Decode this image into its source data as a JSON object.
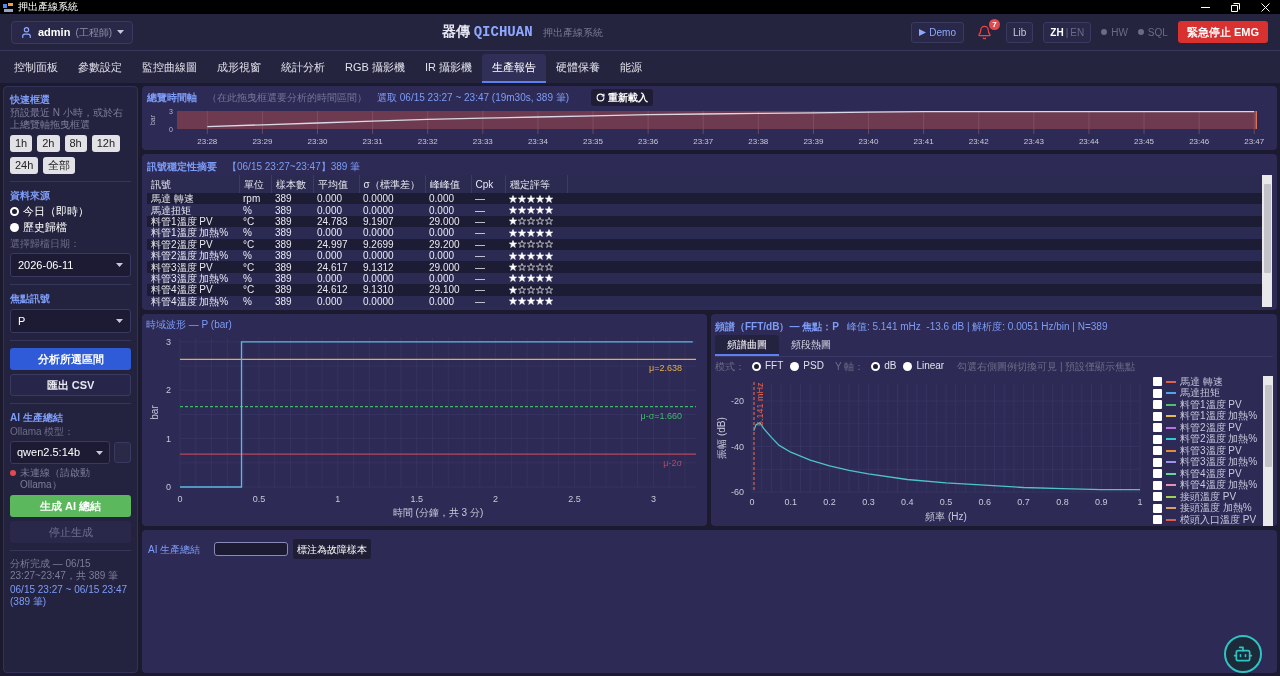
{
  "window": {
    "title": "押出產線系統"
  },
  "header": {
    "user": {
      "name": "admin",
      "role": "(工程師)"
    },
    "brand": {
      "name": "器傳",
      "name_latin": "QICHUAN",
      "subtitle": "押出產線系統"
    },
    "demo_button": "Demo",
    "notifications": {
      "count": "7"
    },
    "lib_button": "Lib",
    "language": {
      "options": [
        {
          "label": "ZH",
          "selected": true
        },
        {
          "label": "EN",
          "selected": false
        }
      ],
      "separator": "|"
    },
    "status": [
      {
        "label": "HW",
        "on": false
      },
      {
        "label": "SQL",
        "on": false
      }
    ],
    "emergency_button": "緊急停止 EMG"
  },
  "tabs": [
    {
      "label": "控制面板",
      "selected": false
    },
    {
      "label": "參數設定",
      "selected": false
    },
    {
      "label": "監控曲線圖",
      "selected": false
    },
    {
      "label": "成形視窗",
      "selected": false
    },
    {
      "label": "統計分析",
      "selected": false
    },
    {
      "label": "RGB 攝影機",
      "selected": false
    },
    {
      "label": "IR 攝影機",
      "selected": false
    },
    {
      "label": "生產報告",
      "selected": true
    },
    {
      "label": "硬體保養",
      "selected": false
    },
    {
      "label": "能源",
      "selected": false
    }
  ],
  "sidebar": {
    "quick_range": {
      "title": "快速框選",
      "hint": "預設最近 N 小時，或於右上總覽軸拖曳框選",
      "buttons": [
        "1h",
        "2h",
        "8h",
        "12h",
        "24h",
        "全部"
      ]
    },
    "source": {
      "title": "資料來源",
      "options": [
        {
          "label": "今日（即時）",
          "selected": true
        },
        {
          "label": "歷史歸檔",
          "selected": false
        }
      ],
      "date_label": "選擇歸檔日期：",
      "date_value": "2026-06-11"
    },
    "focus": {
      "title": "焦點訊號",
      "value": "P"
    },
    "analyze_button": "分析所選區間",
    "export_button": "匯出 CSV",
    "ai": {
      "title": "AI 生產總結",
      "model_label": "Ollama 模型：",
      "model": "qwen2.5:14b",
      "status": {
        "text": "未連線（請啟動 Ollama）",
        "connected": false
      },
      "generate_button": "生成 AI 總結",
      "stop_button": {
        "label": "停止生成",
        "disabled": true
      }
    },
    "result": {
      "message": "分析完成 — 06/15 23:27~23:47，共 389 筆",
      "range": "06/15 23:27 ~ 06/15 23:47 (389 筆)"
    }
  },
  "overview": {
    "title": "總覽時間軸",
    "hint": "（在此拖曳框選要分析的時間區間）",
    "selection": "選取 06/15 23:27 ~ 23:47 (19m30s, 389 筆)",
    "reload_button": "重新載入",
    "chart_data": {
      "type": "line",
      "ylabel": "bar",
      "categories": [
        "23:28",
        "23:29",
        "23:30",
        "23:31",
        "23:32",
        "23:33",
        "23:34",
        "23:35",
        "23:36",
        "23:37",
        "23:38",
        "23:39",
        "23:40",
        "23:41",
        "23:42",
        "23:43",
        "23:44",
        "23:45",
        "23:46",
        "23:47"
      ],
      "series": [
        {
          "color": "#d8d8e8",
          "values": [
            0.4,
            0.7,
            1.0,
            1.3,
            1.6,
            1.8,
            2.0,
            2.2,
            2.4,
            2.5,
            2.6,
            2.7,
            2.8,
            2.9,
            2.9,
            2.9,
            2.9,
            2.9,
            2.9,
            2.9
          ]
        }
      ],
      "ylim": [
        0,
        3
      ],
      "yticks": [
        0,
        3
      ],
      "grid": true
    }
  },
  "summary_table": {
    "title": "訊號穩定性摘要",
    "range": "【06/15 23:27~23:47】389 筆",
    "columns": [
      "訊號",
      "單位",
      "樣本數",
      "平均值",
      "σ（標準差）",
      "峰峰值",
      "Cpk",
      "穩定評等"
    ],
    "rows": [
      {
        "cells": [
          "馬達 轉速",
          "rpm",
          "389",
          "0.000",
          "0.0000",
          "0.000",
          "—"
        ],
        "stars": 5
      },
      {
        "cells": [
          "馬達扭矩",
          "%",
          "389",
          "0.000",
          "0.0000",
          "0.000",
          "—"
        ],
        "stars": 5
      },
      {
        "cells": [
          "料管1溫度 PV",
          "°C",
          "389",
          "24.783",
          "9.1907",
          "29.000",
          "—"
        ],
        "stars": 1
      },
      {
        "cells": [
          "料管1溫度 加熱%",
          "%",
          "389",
          "0.000",
          "0.0000",
          "0.000",
          "—"
        ],
        "stars": 5
      },
      {
        "cells": [
          "料管2溫度 PV",
          "°C",
          "389",
          "24.997",
          "9.2699",
          "29.200",
          "—"
        ],
        "stars": 1
      },
      {
        "cells": [
          "料管2溫度 加熱%",
          "%",
          "389",
          "0.000",
          "0.0000",
          "0.000",
          "—"
        ],
        "stars": 5
      },
      {
        "cells": [
          "料管3溫度 PV",
          "°C",
          "389",
          "24.617",
          "9.1312",
          "29.000",
          "—"
        ],
        "stars": 1
      },
      {
        "cells": [
          "料管3溫度 加熱%",
          "%",
          "389",
          "0.000",
          "0.0000",
          "0.000",
          "—"
        ],
        "stars": 5
      },
      {
        "cells": [
          "料管4溫度 PV",
          "°C",
          "389",
          "24.612",
          "9.1310",
          "29.100",
          "—"
        ],
        "stars": 1
      },
      {
        "cells": [
          "料管4溫度 加熱%",
          "%",
          "389",
          "0.000",
          "0.0000",
          "0.000",
          "—"
        ],
        "stars": 5
      }
    ]
  },
  "waveform": {
    "chart_data": {
      "type": "line",
      "title": "時域波形 — P (bar)",
      "xlabel": "時間 (分鐘，共 3 分)",
      "ylabel": "bar",
      "x": [
        0,
        0.39,
        0.39,
        3.25
      ],
      "series": [
        {
          "color": "#5fb8e0",
          "values": [
            0,
            0,
            3,
            3
          ]
        }
      ],
      "xlim": [
        0,
        3.27
      ],
      "ylim": [
        0,
        3.08
      ],
      "xticks": [
        0,
        0.5,
        1,
        1.5,
        2,
        2.5,
        3
      ],
      "yticks": [
        0,
        1,
        2,
        3
      ],
      "grid": true,
      "ref_lines": [
        {
          "axis": "y",
          "value": 2.638,
          "label": "μ=2.638",
          "color": "#e3ad4c"
        },
        {
          "axis": "y",
          "value": 1.66,
          "label": "μ-σ=1.660",
          "color": "#3fb86a"
        },
        {
          "axis": "y",
          "value": 0.68,
          "label": "μ-2σ",
          "color": "#b9475c"
        }
      ]
    }
  },
  "spectrum": {
    "title": "頻譜（FFT/dB）— 焦點：P",
    "info": "峰值: 5.141 mHz  -13.6 dB | 解析度: 0.0051 Hz/bin | N=389",
    "tabs": [
      {
        "label": "頻譜曲圖",
        "selected": true
      },
      {
        "label": "頻段熱圖",
        "selected": false
      }
    ],
    "mode": {
      "label": "模式：",
      "options": [
        {
          "label": "FFT",
          "selected": true
        },
        {
          "label": "PSD",
          "selected": false
        }
      ]
    },
    "y_axis": {
      "label": "Y 軸：",
      "options": [
        {
          "label": "dB",
          "selected": true
        },
        {
          "label": "Linear",
          "selected": false
        }
      ]
    },
    "hint": "勾選右側圖例切換可見 | 預設僅顯示焦點",
    "chart_data": {
      "type": "line",
      "xlabel": "頻率 (Hz)",
      "ylabel": "振幅 (dB)",
      "x": [
        0.005,
        0.01,
        0.02,
        0.03,
        0.05,
        0.07,
        0.1,
        0.15,
        0.2,
        0.25,
        0.3,
        0.4,
        0.5,
        0.6,
        0.7,
        0.8,
        0.9,
        1
      ],
      "series": [
        {
          "color": "#4fc3c9",
          "values": [
            -33,
            -30.5,
            -29.5,
            -32,
            -36,
            -39.5,
            -42.5,
            -46,
            -48.5,
            -50.5,
            -52,
            -54.5,
            -56,
            -57,
            -58,
            -58.5,
            -59,
            -59
          ]
        }
      ],
      "xlim": [
        0,
        1
      ],
      "ylim": [
        -60,
        -12.5
      ],
      "xticks": [
        0,
        0.1,
        0.2,
        0.3,
        0.4,
        0.5,
        0.6,
        0.7,
        0.8,
        0.9,
        1
      ],
      "yticks": [
        -60,
        -40,
        -20
      ],
      "grid": true,
      "ref_lines": [
        {
          "axis": "x",
          "value": 0.005141,
          "label": "5.141 mHz",
          "color": "#e0604c"
        }
      ]
    },
    "legend": [
      {
        "label": "馬達 轉速",
        "color": "#e0604c",
        "checked": false
      },
      {
        "label": "馬達扭矩",
        "color": "#4aa8e8",
        "checked": false
      },
      {
        "label": "料管1溫度 PV",
        "color": "#4cc06a",
        "checked": false
      },
      {
        "label": "料管1溫度 加熱%",
        "color": "#e8b84a",
        "checked": false
      },
      {
        "label": "料管2溫度 PV",
        "color": "#c070e0",
        "checked": false
      },
      {
        "label": "料管2溫度 加熱%",
        "color": "#30c8d8",
        "checked": false
      },
      {
        "label": "料管3溫度 PV",
        "color": "#e88a3a",
        "checked": false
      },
      {
        "label": "料管3溫度 加熱%",
        "color": "#a090f0",
        "checked": false
      },
      {
        "label": "料管4溫度 PV",
        "color": "#60d8a0",
        "checked": false
      },
      {
        "label": "料管4溫度 加熱%",
        "color": "#e890b0",
        "checked": false
      },
      {
        "label": "接頭溫度 PV",
        "color": "#a0d050",
        "checked": false
      },
      {
        "label": "接頭溫度 加熱%",
        "color": "#d8a070",
        "checked": false
      },
      {
        "label": "模頭入口溫度 PV",
        "color": "#e05a4a",
        "checked": false
      }
    ]
  },
  "ai_summary": {
    "title": "AI 生產總結",
    "mark_button": "標注為故障樣本"
  }
}
